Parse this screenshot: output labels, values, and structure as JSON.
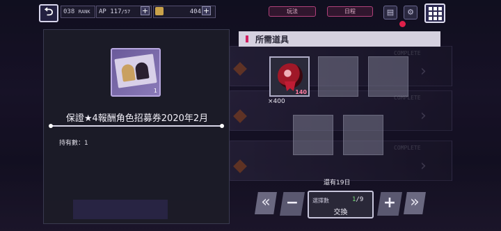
{
  "topbar": {
    "rank_value": "038",
    "rank_label": "RANK",
    "ap_label": "AP",
    "ap_value": "117",
    "ap_max": "/57",
    "gold_value": "404",
    "pill_1": "玩法",
    "pill_2": "日程"
  },
  "reward": {
    "ticket_count": "1",
    "name": "保證★4報酬角色招募券2020年2月",
    "owned": "持有數：1"
  },
  "required": {
    "header": "所需道具",
    "item_count": "140",
    "quantity": "×400"
  },
  "remaining": "還有19日",
  "exchange": {
    "label": "選擇數",
    "selected": "1",
    "max": "/9",
    "button": "交換"
  },
  "controls": {
    "min": "«",
    "minus": "−",
    "plus": "+",
    "max": "»"
  },
  "colors": {
    "accent_pink": "#d02060",
    "count_green": "#7ae07a",
    "panel_bg": "#1c1c28"
  }
}
